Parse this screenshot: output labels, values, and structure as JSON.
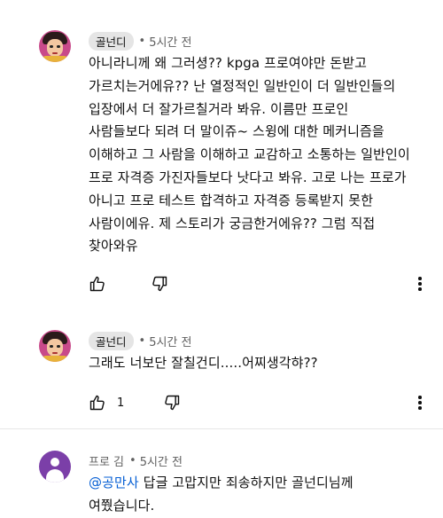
{
  "comments": [
    {
      "author": "골넌디",
      "author_style": "badge",
      "time": "5시간 전",
      "text": "아니라니께 왜 그러셩?? kpga 프로여야만 돈받고\n가르치는거에유?? 난 열정적인 일반인이 더 일반인들의\n입장에서 더 잘가르칠거라 봐유. 이름만 프로인\n사람들보다 되려 더 말이쥬~ 스윙에 대한 메커니즘을\n이해하고 그 사람을 이해하고 교감하고 소통하는 일반인이\n프로 자격증 가진자들보다 낫다고 봐유. 고로 나는 프로가\n아니고 프로 테스트 합격하고 자격증 등록받지 못한\n사람이에유. 제 스토리가 궁금한거에유?? 그럼 직접\n찾아와유",
      "like_count": "",
      "avatar": "cartoon-avatar"
    },
    {
      "author": "골넌디",
      "author_style": "badge",
      "time": "5시간 전",
      "text": "그래도 너보단 잘칠건디.....어찌생각햐??",
      "like_count": "1",
      "avatar": "cartoon-avatar"
    },
    {
      "author": "프로 김",
      "author_style": "plain",
      "time": "5시간 전",
      "mention": "@공만사",
      "text": "  답글 고맙지만 죄송하지만 골넌디님께\n여쭸습니다.",
      "like_count": "",
      "avatar": "default-purple-avatar"
    }
  ],
  "separator": "•",
  "icons": {
    "like": "thumb-up-icon",
    "dislike": "thumb-down-icon",
    "more": "more-vert-icon"
  },
  "colors": {
    "text": "#0f0f0f",
    "meta": "#606060",
    "badge_bg": "#e5e5e5",
    "mention": "#065fd4",
    "avatar_purple": "#7b3fa8"
  }
}
